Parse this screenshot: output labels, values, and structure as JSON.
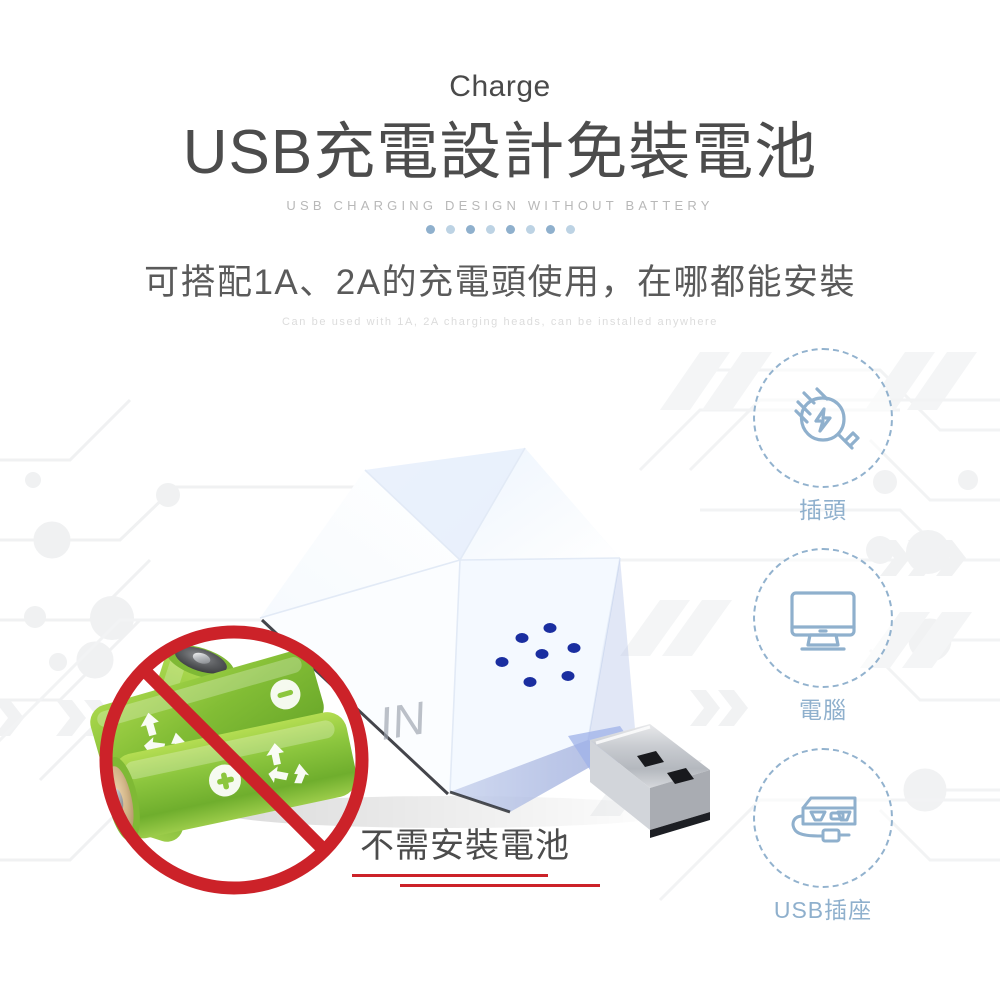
{
  "header": {
    "eyebrow": "Charge",
    "title": "USB充電設計免裝電池",
    "title_en": "USB CHARGING DESIGN WITHOUT BATTERY",
    "subtitle": "可搭配1A、2A的充電頭使用，在哪都能安裝",
    "subtitle_en": "Can be used with 1A, 2A charging heads, can be installed anywhere"
  },
  "dots": {
    "count": 8,
    "color_dark": "#8fb0cd",
    "color_light": "#bdd3e4"
  },
  "badges": [
    {
      "id": "plug",
      "icon": "power-plug-icon",
      "label": "插頭"
    },
    {
      "id": "pc",
      "icon": "desktop-monitor-icon",
      "label": "電腦"
    },
    {
      "id": "usb",
      "icon": "usb-power-strip-icon",
      "label": "USB插座"
    }
  ],
  "callout": {
    "no_battery_label": "不需安裝電池",
    "underline_color": "#cc2229"
  },
  "product": {
    "brand_mark": "IN",
    "led_dot_count": 7,
    "led_color": "#1a2ea0",
    "body_color": "#f3f8ff",
    "connector_color": "#bfc2c7"
  },
  "battery_graphic": {
    "battery_count": 3,
    "body_color": "#8dc63f",
    "prohibition_color": "#cc2229",
    "symbols": [
      "recycle",
      "plus",
      "minus"
    ]
  },
  "palette": {
    "accent_blue": "#8fb0cd",
    "text_dark": "#4c4c4c",
    "text_muted": "#b8b8b8",
    "bg": "#ffffff"
  }
}
